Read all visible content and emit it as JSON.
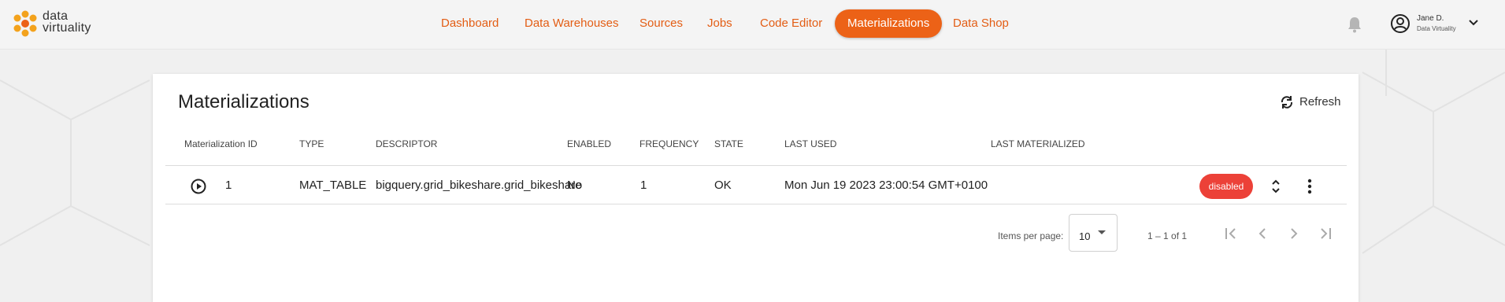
{
  "brand": {
    "line1": "data",
    "line2": "virtuality",
    "accent": "#ec6217"
  },
  "nav": {
    "items": [
      {
        "label": "Dashboard",
        "active": false
      },
      {
        "label": "Data Warehouses",
        "active": false
      },
      {
        "label": "Sources",
        "active": false
      },
      {
        "label": "Jobs",
        "active": false
      },
      {
        "label": "Code Editor",
        "active": false
      },
      {
        "label": "Materializations",
        "active": true
      },
      {
        "label": "Data Shop",
        "active": false
      }
    ]
  },
  "header_icons": {
    "notifications": "bell-icon",
    "account": "user-circle-icon",
    "menu": "chevron-down-icon"
  },
  "user": {
    "name": "Jane D.",
    "org": "Data Virtuality"
  },
  "page": {
    "title": "Materializations",
    "refresh_label": "Refresh"
  },
  "table": {
    "columns": [
      "Materialization ID",
      "TYPE",
      "DESCRIPTOR",
      "ENABLED",
      "FREQUENCY",
      "STATE",
      "LAST USED",
      "LAST MATERIALIZED"
    ],
    "rows": [
      {
        "id": "1",
        "type": "MAT_TABLE",
        "descriptor": "bigquery.grid_bikeshare.grid_bikeshare",
        "enabled": "No",
        "frequency": "1",
        "state": "OK",
        "last_used": "Mon Jun 19 2023 23:00:54 GMT+0100",
        "last_materialized": "",
        "status_badge": "disabled",
        "badge_color": "#ec4138"
      }
    ]
  },
  "pagination": {
    "items_per_page_label": "Items per page:",
    "items_per_page": "10",
    "range_label": "1 – 1 of 1"
  }
}
